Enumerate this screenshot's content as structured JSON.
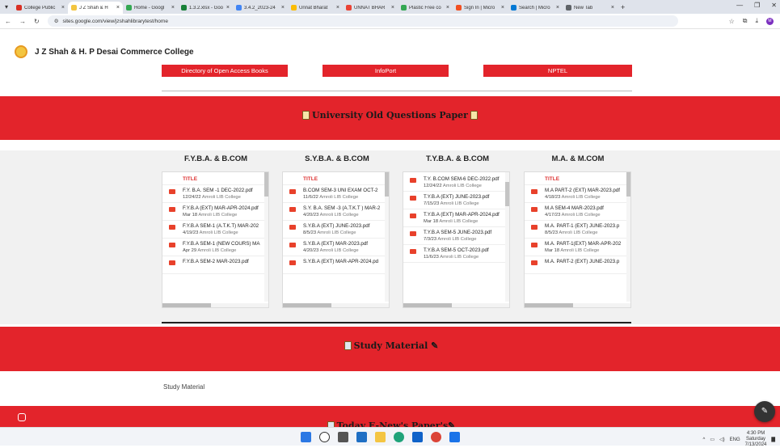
{
  "browser": {
    "tabs": [
      {
        "title": "College Public",
        "color": "#d93025"
      },
      {
        "title": "J Z Shah & H",
        "color": "#f3c540",
        "active": true
      },
      {
        "title": "Home - Googl",
        "color": "#34a853"
      },
      {
        "title": "1.3.2.xlsx - Goo",
        "color": "#188038"
      },
      {
        "title": "3.4.2_2023-24",
        "color": "#4285f4"
      },
      {
        "title": "Unnat Bharat",
        "color": "#fbbc04"
      },
      {
        "title": "UNNAT BHAR",
        "color": "#ea4335"
      },
      {
        "title": "Plastic Free co",
        "color": "#34a853"
      },
      {
        "title": "Sign In | Micro",
        "color": "#f25022"
      },
      {
        "title": "Search | Micro",
        "color": "#0078d4"
      },
      {
        "title": "New Tab",
        "color": "#5f6368"
      }
    ],
    "url": "sites.google.com/view/jzshahlibrarytest/home",
    "avatar_letter": "M"
  },
  "site": {
    "title": "J Z Shah & H. P Desai Commerce College",
    "nav_buttons": [
      "Directory of Open Access Books",
      "InfoPort",
      "NPTEL"
    ],
    "oqp_heading": "University Old Questions Paper",
    "study_heading": "Study Material",
    "study_text": "Study Material",
    "news_heading": "Today E-New's Paper's"
  },
  "columns": [
    {
      "heading": "F.Y.B.A. & B.COM",
      "table_header": "TITLE",
      "files": [
        {
          "name": "F.Y. B.A. SEM -1 DEC-2022.pdf",
          "date": "12/24/22",
          "by": "Amroli LIB College"
        },
        {
          "name": "F.Y.B.A (EXT) MAR-APR-2024.pdf",
          "date": "Mar 18",
          "by": "Amroli LIB College"
        },
        {
          "name": "F.Y.B.A SEM-1 (A.T.K.T) MAR-202",
          "date": "4/19/23",
          "by": "Amroli LIB College"
        },
        {
          "name": "F.Y.B.A SEM-1 (NEW COURS) MA",
          "date": "Apr 29",
          "by": "Amroli LIB College"
        },
        {
          "name": "F.Y.B.A SEM-2 MAR-2023.pdf",
          "date": "",
          "by": ""
        }
      ]
    },
    {
      "heading": "S.Y.B.A. & B.COM",
      "table_header": "TITLE",
      "files": [
        {
          "name": "B.COM SEM-3 UNI EXAM OCT-2",
          "date": "11/6/22",
          "by": "Amroli LIB College"
        },
        {
          "name": "S.Y. B.A. SEM -3 (A.T.K.T ) MAR-2",
          "date": "4/20/23",
          "by": "Amroli LIB College"
        },
        {
          "name": "S.Y.B.A (EXT) JUNE-2023.pdf",
          "date": "8/5/23",
          "by": "Amroli LIB College"
        },
        {
          "name": "S.Y.B.A (EXT) MAR-2023.pdf",
          "date": "4/20/23",
          "by": "Amroli LIB College"
        },
        {
          "name": "S.Y.B.A (EXT) MAR-APR-2024.pd",
          "date": "",
          "by": ""
        }
      ]
    },
    {
      "heading": "T.Y.B.A. & B.COM",
      "table_header": "",
      "files": [
        {
          "name": "T.Y. B.COM SEM-6 DEC-2022.pdf",
          "date": "12/24/22",
          "by": "Amroli LIB College"
        },
        {
          "name": "T.Y.B.A (EXT) JUNE-2023.pdf",
          "date": "7/15/23",
          "by": "Amroli LIB College"
        },
        {
          "name": "T.Y.B.A (EXT) MAR-APR-2024.pdf",
          "date": "Mar 18",
          "by": "Amroli LIB College"
        },
        {
          "name": "T.Y.B.A SEM-5 JUNE-2023.pdf",
          "date": "7/3/23",
          "by": "Amroli LIB College"
        },
        {
          "name": "T.Y.B.A SEM-5 OCT-2023.pdf",
          "date": "11/6/23",
          "by": "Amroli LIB College"
        }
      ]
    },
    {
      "heading": "M.A. & M.COM",
      "table_header": "TITLE",
      "files": [
        {
          "name": "M.A PART-2 (EXT) MAR-2023.pdf",
          "date": "4/18/23",
          "by": "Amroli LIB College"
        },
        {
          "name": "M.A SEM-4 MAR-2023.pdf",
          "date": "4/17/23",
          "by": "Amroli LIB College"
        },
        {
          "name": "M.A. PART-1 (EXT) JUNE-2023.p",
          "date": "8/5/23",
          "by": "Amroli LIB College"
        },
        {
          "name": "M.A. PART-1(EXT) MAR-APR-202",
          "date": "Mar 18",
          "by": "Amroli LIB College"
        },
        {
          "name": "M.A. PART-2 (EXT) JUNE-2023.p",
          "date": "",
          "by": ""
        }
      ]
    }
  ],
  "taskbar": {
    "lang": "ENG",
    "time": "4:30 PM",
    "day": "Saturday",
    "date": "7/13/2024"
  },
  "colors": {
    "brand_red": "#e3242b"
  }
}
